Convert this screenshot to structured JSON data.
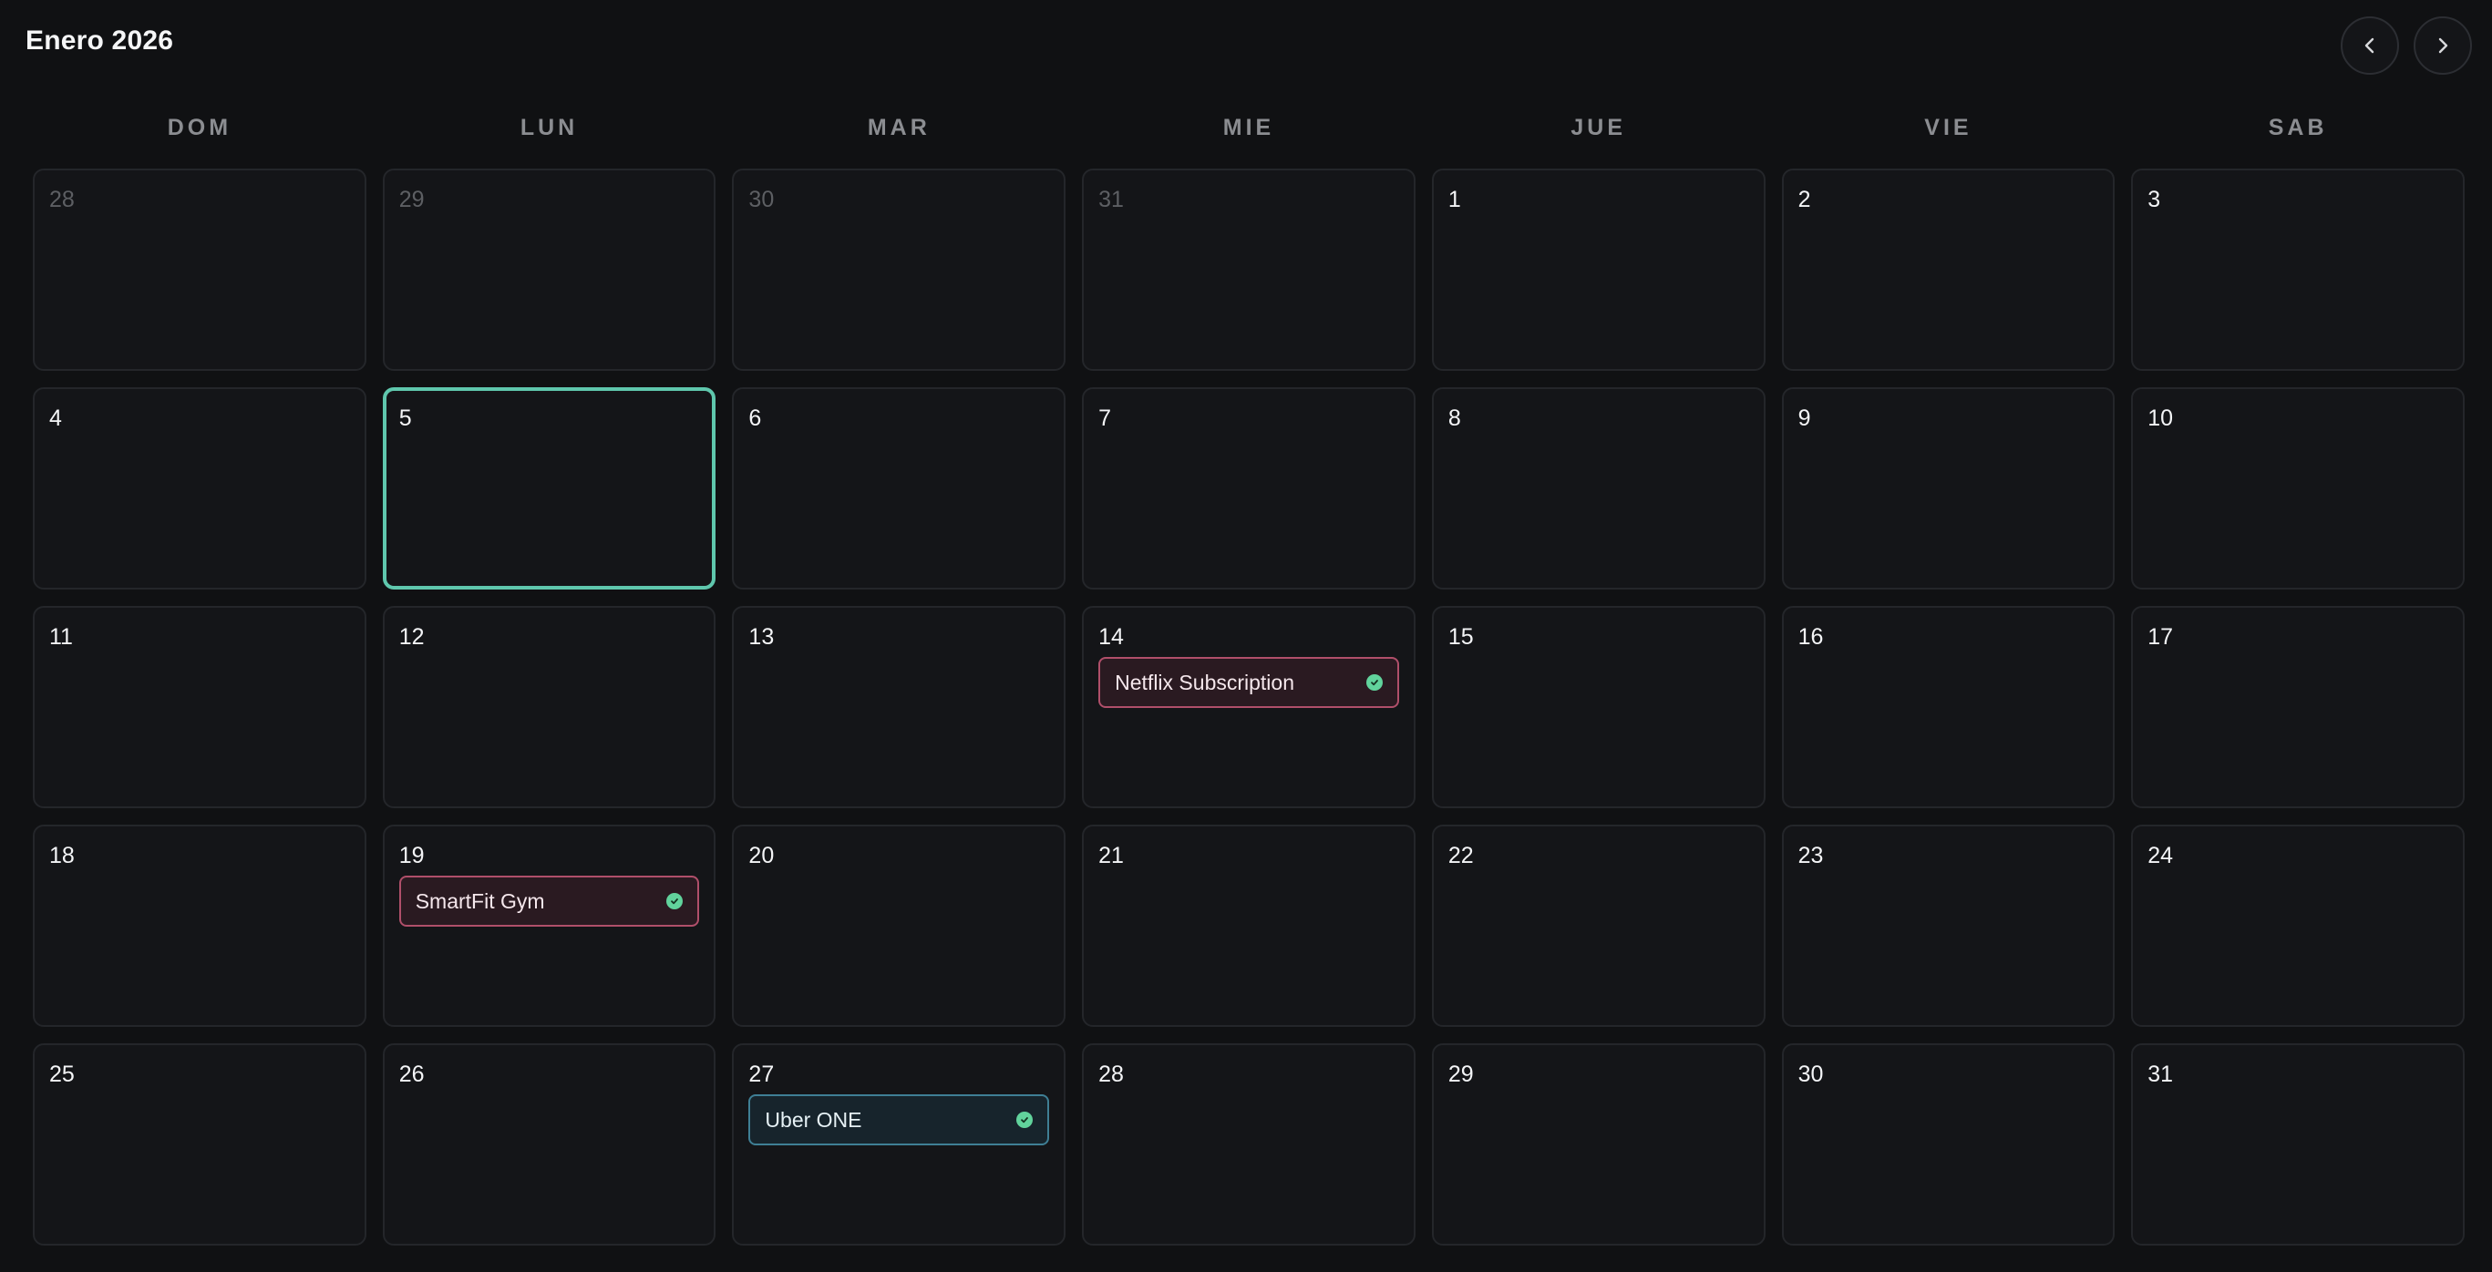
{
  "header": {
    "title": "Enero 2026",
    "prev_icon": "chevron-left-icon",
    "next_icon": "chevron-right-icon"
  },
  "weekdays": [
    "DOM",
    "LUN",
    "MAR",
    "MIE",
    "JUE",
    "VIE",
    "SAB"
  ],
  "colors": {
    "today_border": "#5fc7ad",
    "event_pink_border": "#b04f6a",
    "event_blue_border": "#3f7f95",
    "paid_check": "#61d39c"
  },
  "days": [
    {
      "num": "28",
      "outside": true
    },
    {
      "num": "29",
      "outside": true
    },
    {
      "num": "30",
      "outside": true
    },
    {
      "num": "31",
      "outside": true
    },
    {
      "num": "1"
    },
    {
      "num": "2"
    },
    {
      "num": "3"
    },
    {
      "num": "4"
    },
    {
      "num": "5",
      "today": true
    },
    {
      "num": "6"
    },
    {
      "num": "7"
    },
    {
      "num": "8"
    },
    {
      "num": "9"
    },
    {
      "num": "10"
    },
    {
      "num": "11"
    },
    {
      "num": "12"
    },
    {
      "num": "13"
    },
    {
      "num": "14",
      "events": [
        {
          "label": "Netflix Subscription",
          "style": "pink",
          "status_icon": "check-circle-icon"
        }
      ]
    },
    {
      "num": "15"
    },
    {
      "num": "16"
    },
    {
      "num": "17"
    },
    {
      "num": "18"
    },
    {
      "num": "19",
      "events": [
        {
          "label": "SmartFit Gym",
          "style": "pink",
          "status_icon": "check-circle-icon"
        }
      ]
    },
    {
      "num": "20"
    },
    {
      "num": "21"
    },
    {
      "num": "22"
    },
    {
      "num": "23"
    },
    {
      "num": "24"
    },
    {
      "num": "25"
    },
    {
      "num": "26"
    },
    {
      "num": "27",
      "events": [
        {
          "label": "Uber ONE",
          "style": "blue",
          "status_icon": "check-circle-icon"
        }
      ]
    },
    {
      "num": "28"
    },
    {
      "num": "29"
    },
    {
      "num": "30"
    },
    {
      "num": "31"
    }
  ]
}
